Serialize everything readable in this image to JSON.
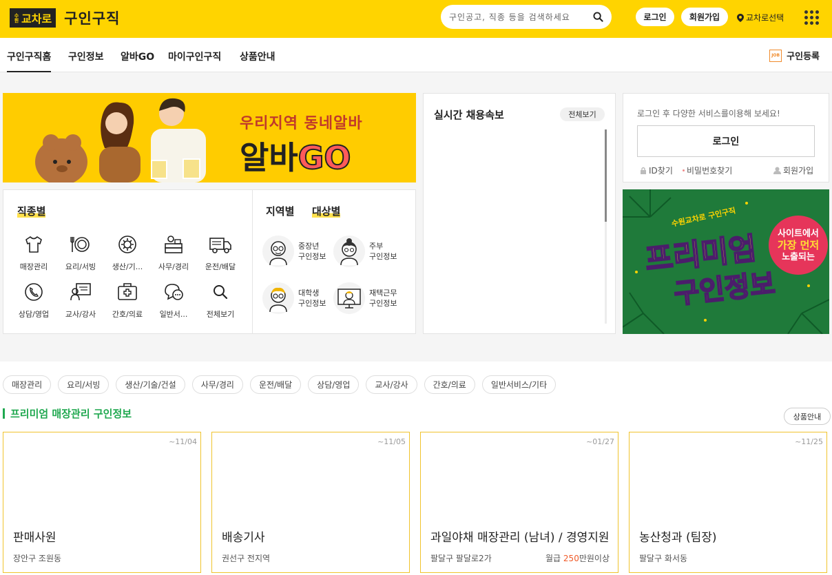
{
  "header": {
    "logo_small": "수원",
    "logo_text": "교차로",
    "title": "구인구직",
    "search_placeholder": "구인공고, 직종 등을 검색하세요",
    "login_label": "로그인",
    "signup_label": "회원가입",
    "location_label": "교차로선택"
  },
  "nav": {
    "items": [
      "구인구직홈",
      "구인정보",
      "알바GO",
      "마이구인구직",
      "상품안내"
    ],
    "register_label": "구인등록",
    "register_icon_text": "JOB"
  },
  "banner": {
    "sub": "우리지역 동네알바",
    "main_a": "알바",
    "main_b": "GO"
  },
  "categories": {
    "heading": "직종별",
    "items": [
      {
        "label": "매장관리",
        "icon": "shirt-icon"
      },
      {
        "label": "요리/서빙",
        "icon": "dish-icon"
      },
      {
        "label": "생산/기...",
        "icon": "gear-icon"
      },
      {
        "label": "사무/경리",
        "icon": "desk-icon"
      },
      {
        "label": "운전/배달",
        "icon": "truck-icon"
      },
      {
        "label": "상담/영업",
        "icon": "phone-icon"
      },
      {
        "label": "교사/강사",
        "icon": "teacher-icon"
      },
      {
        "label": "간호/의료",
        "icon": "medical-icon"
      },
      {
        "label": "일반서...",
        "icon": "chat-icon"
      },
      {
        "label": "전체보기",
        "icon": "search-icon"
      }
    ],
    "tab_region": "지역별",
    "tab_target": "대상별",
    "targets": [
      {
        "line1": "중장년",
        "line2": "구인정보"
      },
      {
        "line1": "주부",
        "line2": "구인정보"
      },
      {
        "line1": "대학생",
        "line2": "구인정보"
      },
      {
        "line1": "재택근무",
        "line2": "구인정보"
      }
    ]
  },
  "realtime": {
    "title": "실시간 채용속보",
    "all_label": "전체보기"
  },
  "login_box": {
    "message": "로그인 후 다양한 서비스를이용해 보세요!",
    "button": "로그인",
    "find_id": "ID찾기",
    "find_pw": "비밀번호찾기",
    "signup": "회원가입"
  },
  "premium_banner": {
    "top": "수원교차로 구인구직",
    "line1": "프리미엄",
    "line2": "구인정보",
    "badge1": "사이트에서",
    "badge2": "가장 먼저",
    "badge3": "노출되는"
  },
  "chips": [
    "매장관리",
    "요리/서빙",
    "생산/기술/건설",
    "사무/경리",
    "운전/배달",
    "상담/영업",
    "교사/강사",
    "간호/의료",
    "일반서비스/기타"
  ],
  "section": {
    "title": "프리미엄 매장관리 구인정보",
    "product_label": "상품안내"
  },
  "cards": [
    {
      "date": "~11/04",
      "title": "판매사원",
      "location": "장안구 조원동",
      "pay_prefix": "",
      "pay_amount": "",
      "pay_suffix": ""
    },
    {
      "date": "~11/05",
      "title": "배송기사",
      "location": "권선구 전지역",
      "pay_prefix": "",
      "pay_amount": "",
      "pay_suffix": ""
    },
    {
      "date": "~01/27",
      "title": "과일야채 매장관리 (남녀) / 경영지원",
      "location": "팔달구 팔달로2가",
      "pay_prefix": "월급 ",
      "pay_amount": "250",
      "pay_suffix": "만원이상"
    },
    {
      "date": "~11/25",
      "title": "농산청과 (팀장)",
      "location": "팔달구 화서동",
      "pay_prefix": "",
      "pay_amount": "",
      "pay_suffix": ""
    }
  ],
  "colors": {
    "brand_yellow": "#ffd400",
    "section_green": "#1fa84f",
    "card_border": "#f0c32c",
    "pay_highlight": "#f05a28"
  }
}
